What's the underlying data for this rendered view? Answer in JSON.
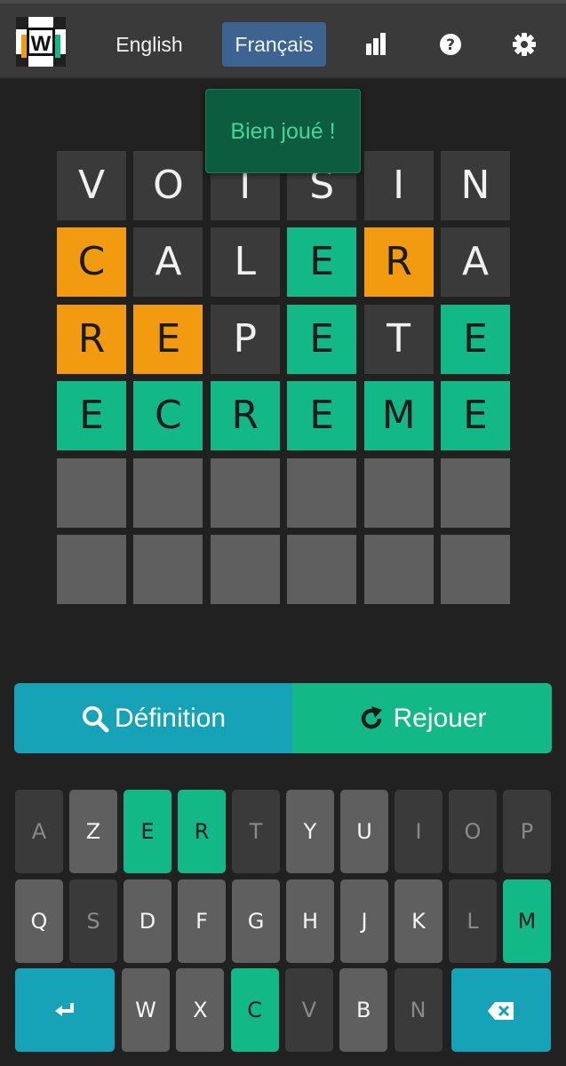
{
  "header": {
    "logo_letter": "W",
    "languages": [
      {
        "label": "English",
        "active": false
      },
      {
        "label": "Français",
        "active": true
      }
    ],
    "icons": [
      "stats-icon",
      "help-icon",
      "settings-gear-icon"
    ]
  },
  "toast": {
    "message": "Bien joué !"
  },
  "board": {
    "rows": [
      {
        "letters": [
          "V",
          "O",
          "I",
          "S",
          "I",
          "N"
        ],
        "states": [
          "gray",
          "gray",
          "gray",
          "gray",
          "gray",
          "gray"
        ]
      },
      {
        "letters": [
          "C",
          "A",
          "L",
          "E",
          "R",
          "A"
        ],
        "states": [
          "yellow",
          "gray",
          "gray",
          "green",
          "yellow",
          "gray"
        ]
      },
      {
        "letters": [
          "R",
          "E",
          "P",
          "E",
          "T",
          "E"
        ],
        "states": [
          "yellow",
          "yellow",
          "gray",
          "green",
          "gray",
          "green"
        ]
      },
      {
        "letters": [
          "E",
          "C",
          "R",
          "E",
          "M",
          "E"
        ],
        "states": [
          "green",
          "green",
          "green",
          "green",
          "green",
          "green"
        ]
      },
      {
        "letters": [
          "",
          "",
          "",
          "",
          "",
          ""
        ],
        "states": [
          "empty",
          "empty",
          "empty",
          "empty",
          "empty",
          "empty"
        ]
      },
      {
        "letters": [
          "",
          "",
          "",
          "",
          "",
          ""
        ],
        "states": [
          "empty",
          "empty",
          "empty",
          "empty",
          "empty",
          "empty"
        ]
      }
    ]
  },
  "actions": {
    "definition_label": "Définition",
    "replay_label": "Rejouer"
  },
  "keyboard": {
    "row1": [
      {
        "k": "A",
        "s": "absent"
      },
      {
        "k": "Z",
        "s": "unused"
      },
      {
        "k": "E",
        "s": "correct"
      },
      {
        "k": "R",
        "s": "correct"
      },
      {
        "k": "T",
        "s": "absent"
      },
      {
        "k": "Y",
        "s": "unused"
      },
      {
        "k": "U",
        "s": "unused"
      },
      {
        "k": "I",
        "s": "absent"
      },
      {
        "k": "O",
        "s": "absent"
      },
      {
        "k": "P",
        "s": "absent"
      }
    ],
    "row2": [
      {
        "k": "Q",
        "s": "unused"
      },
      {
        "k": "S",
        "s": "absent"
      },
      {
        "k": "D",
        "s": "unused"
      },
      {
        "k": "F",
        "s": "unused"
      },
      {
        "k": "G",
        "s": "unused"
      },
      {
        "k": "H",
        "s": "unused"
      },
      {
        "k": "J",
        "s": "unused"
      },
      {
        "k": "K",
        "s": "unused"
      },
      {
        "k": "L",
        "s": "absent"
      },
      {
        "k": "M",
        "s": "correct"
      }
    ],
    "row3": [
      {
        "k": "W",
        "s": "unused"
      },
      {
        "k": "X",
        "s": "unused"
      },
      {
        "k": "C",
        "s": "correct"
      },
      {
        "k": "V",
        "s": "absent"
      },
      {
        "k": "B",
        "s": "unused"
      },
      {
        "k": "N",
        "s": "absent"
      }
    ],
    "enter_icon": "enter-icon",
    "backspace_icon": "backspace-icon"
  },
  "colors": {
    "correct": "#12b886",
    "present": "#f29b11",
    "absent": "#3a3a3a",
    "empty": "#5f5f5f",
    "accent_blue": "#16a3b8",
    "active_lang": "#3d6491"
  }
}
